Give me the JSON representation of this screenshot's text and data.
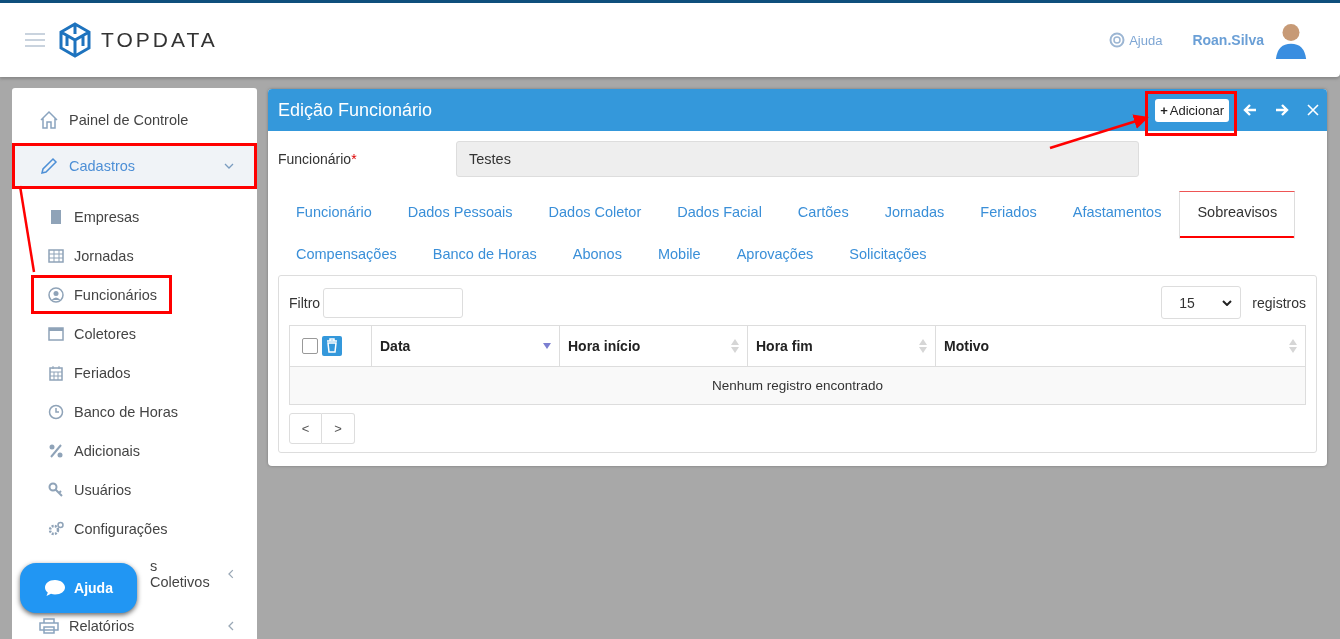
{
  "header": {
    "brand": "TOPDATA",
    "help": "Ajuda",
    "user": "Roan.Silva"
  },
  "sidebar": {
    "items": [
      {
        "label": "Painel de Controle",
        "selected": false,
        "highlighted": false
      },
      {
        "label": "Cadastros",
        "selected": true,
        "highlighted": true,
        "expanded": true,
        "children": [
          {
            "label": "Empresas",
            "highlighted": false
          },
          {
            "label": "Jornadas",
            "highlighted": false
          },
          {
            "label": "Funcionários",
            "highlighted": true
          },
          {
            "label": "Coletores",
            "highlighted": false
          },
          {
            "label": "Feriados",
            "highlighted": false
          },
          {
            "label": "Banco de Horas",
            "highlighted": false
          },
          {
            "label": "Adicionais",
            "highlighted": false
          },
          {
            "label": "Usuários",
            "highlighted": false
          },
          {
            "label": "Configurações",
            "highlighted": false
          }
        ]
      },
      {
        "label": "s Coletivos",
        "selected": false,
        "highlighted": false,
        "expanded": false
      },
      {
        "label": "Relatórios",
        "selected": false,
        "highlighted": false,
        "expanded": false
      }
    ]
  },
  "help_button": {
    "label": "Ajuda"
  },
  "panel": {
    "title": "Edição Funcionário",
    "add_button": {
      "symbol": "+",
      "label": "Adicionar",
      "highlighted": true
    },
    "field": {
      "label": "Funcionário",
      "required_mark": "*",
      "value": "Testes"
    },
    "tabs": [
      {
        "label": "Funcionário",
        "selected": false,
        "highlighted": false
      },
      {
        "label": "Dados Pessoais",
        "selected": false,
        "highlighted": false
      },
      {
        "label": "Dados Coletor",
        "selected": false,
        "highlighted": false
      },
      {
        "label": "Dados Facial",
        "selected": false,
        "highlighted": false
      },
      {
        "label": "Cartões",
        "selected": false,
        "highlighted": false
      },
      {
        "label": "Jornadas",
        "selected": false,
        "highlighted": false
      },
      {
        "label": "Feriados",
        "selected": false,
        "highlighted": false
      },
      {
        "label": "Afastamentos",
        "selected": false,
        "highlighted": false
      },
      {
        "label": "Sobreavisos",
        "selected": true,
        "highlighted": true
      },
      {
        "label": "Compensações",
        "selected": false,
        "highlighted": false
      },
      {
        "label": "Banco de Horas",
        "selected": false,
        "highlighted": false
      },
      {
        "label": "Abonos",
        "selected": false,
        "highlighted": false
      },
      {
        "label": "Mobile",
        "selected": false,
        "highlighted": false
      },
      {
        "label": "Aprovações",
        "selected": false,
        "highlighted": false
      },
      {
        "label": "Solicitações",
        "selected": false,
        "highlighted": false
      }
    ],
    "filter_label": "Filtro",
    "page_size": "15",
    "page_size_label": "registros",
    "table": {
      "select_all": false,
      "columns": [
        {
          "label": "Data",
          "sorted": true
        },
        {
          "label": "Hora início",
          "sorted": false
        },
        {
          "label": "Hora fim",
          "sorted": false
        },
        {
          "label": "Motivo",
          "sorted": false
        }
      ],
      "empty_message": "Nenhum registro encontrado"
    },
    "pager": [
      "<",
      ">"
    ]
  }
}
